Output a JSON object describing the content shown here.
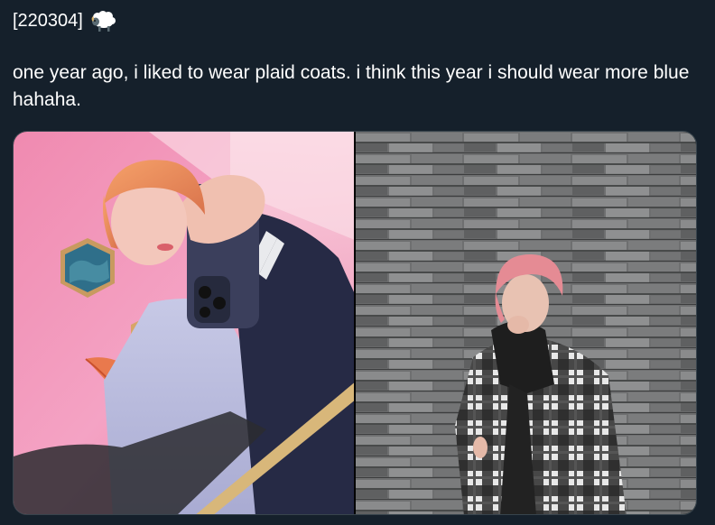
{
  "tweet": {
    "tag": "[220304]",
    "tag_emoji": "sheep-emoji",
    "text": "one year ago, i liked to wear plaid coats. i think this year i should wear more blue hahaha."
  },
  "media": {
    "photos": [
      {
        "name": "mirror-selfie-photo"
      },
      {
        "name": "stone-wall-photo"
      }
    ]
  },
  "colors": {
    "background": "#15202b",
    "text": "#ffffff",
    "border": "#38444d"
  }
}
